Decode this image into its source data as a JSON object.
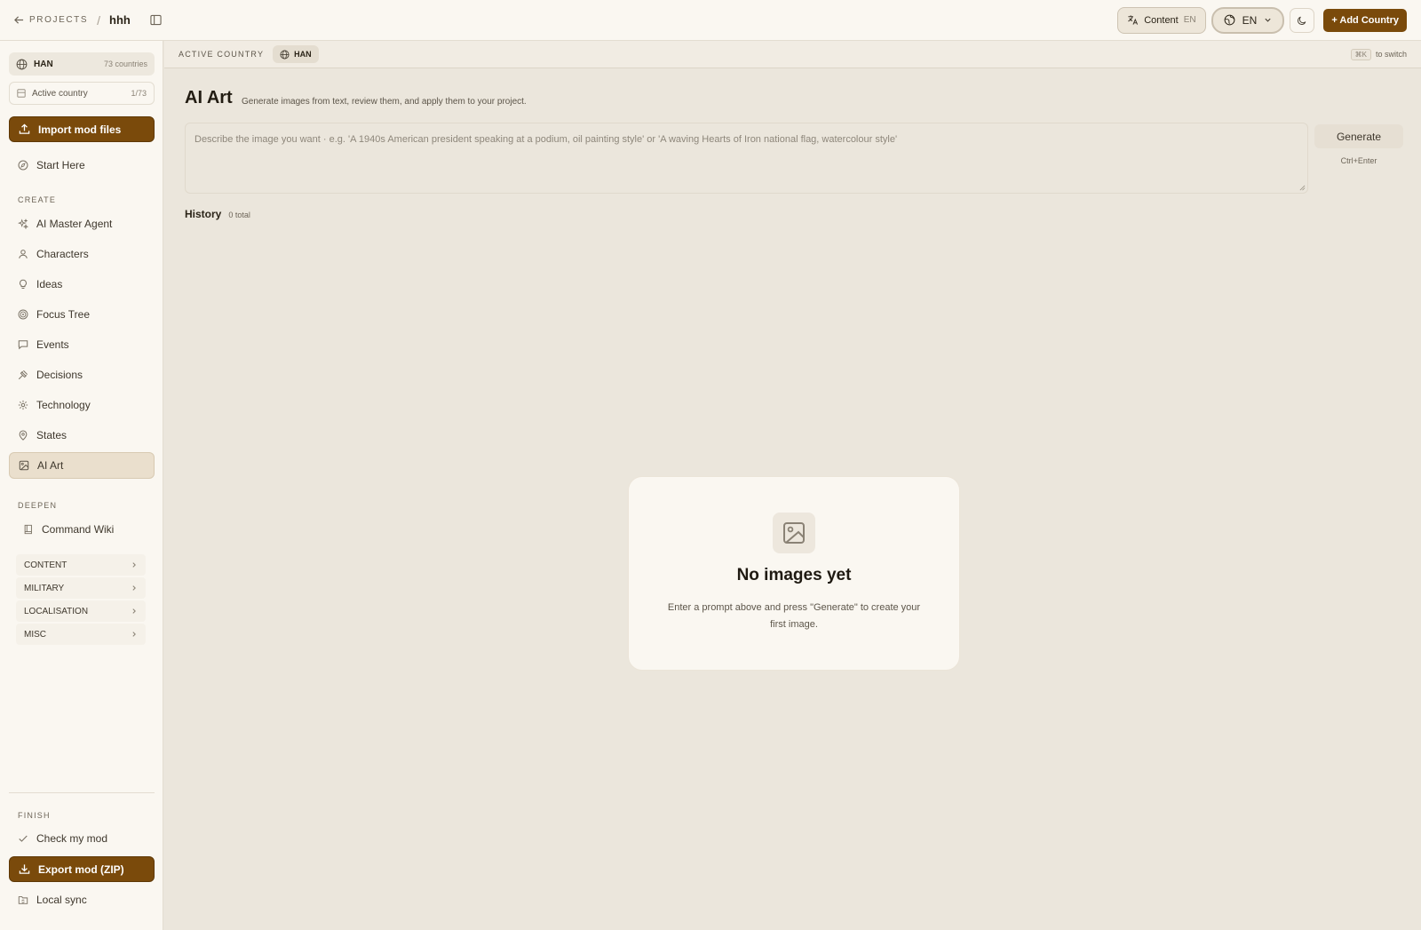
{
  "topbar": {
    "back_label": "PROJECTS",
    "separator": "/",
    "project_name": "hhh",
    "content_label": "Content",
    "content_lang": "EN",
    "lang_label": "EN",
    "add_country_label": "+ Add Country"
  },
  "sidebar": {
    "country_code": "HAN",
    "country_count": "73 countries",
    "active_country_label": "Active country",
    "active_country_pos": "1/73",
    "import_label": "Import mod files",
    "start_here": "Start Here",
    "create_label": "CREATE",
    "create_items": [
      "AI Master Agent",
      "Characters",
      "Ideas",
      "Focus Tree",
      "Events",
      "Decisions",
      "Technology",
      "States",
      "AI Art"
    ],
    "deepen_label": "DEEPEN",
    "command_wiki": "Command Wiki",
    "groups": [
      "CONTENT",
      "MILITARY",
      "LOCALISATION",
      "MISC"
    ],
    "finish_label": "FINISH",
    "check_mod": "Check my mod",
    "export_label": "Export mod (ZIP)",
    "local_sync": "Local sync"
  },
  "subbar": {
    "active_label": "ACTIVE COUNTRY",
    "country_code": "HAN",
    "shortcut": "⌘K",
    "shortcut_hint": "to switch"
  },
  "main": {
    "title": "AI Art",
    "subtitle": "Generate images from text, review them, and apply them to your project.",
    "prompt_placeholder": "Describe the image you want · e.g. 'A 1940s American president speaking at a podium, oil painting style' or 'A waving Hearts of Iron national flag, watercolour style'",
    "generate_label": "Generate",
    "generate_hint": "Ctrl+Enter",
    "history_label": "History",
    "history_count": "0 total",
    "empty_title": "No images yet",
    "empty_desc": "Enter a prompt above and press \"Generate\" to create your first image."
  },
  "colors": {
    "accent": "#7a4a0b",
    "background": "#ebe6dc",
    "sidebar": "#faf7f1"
  }
}
